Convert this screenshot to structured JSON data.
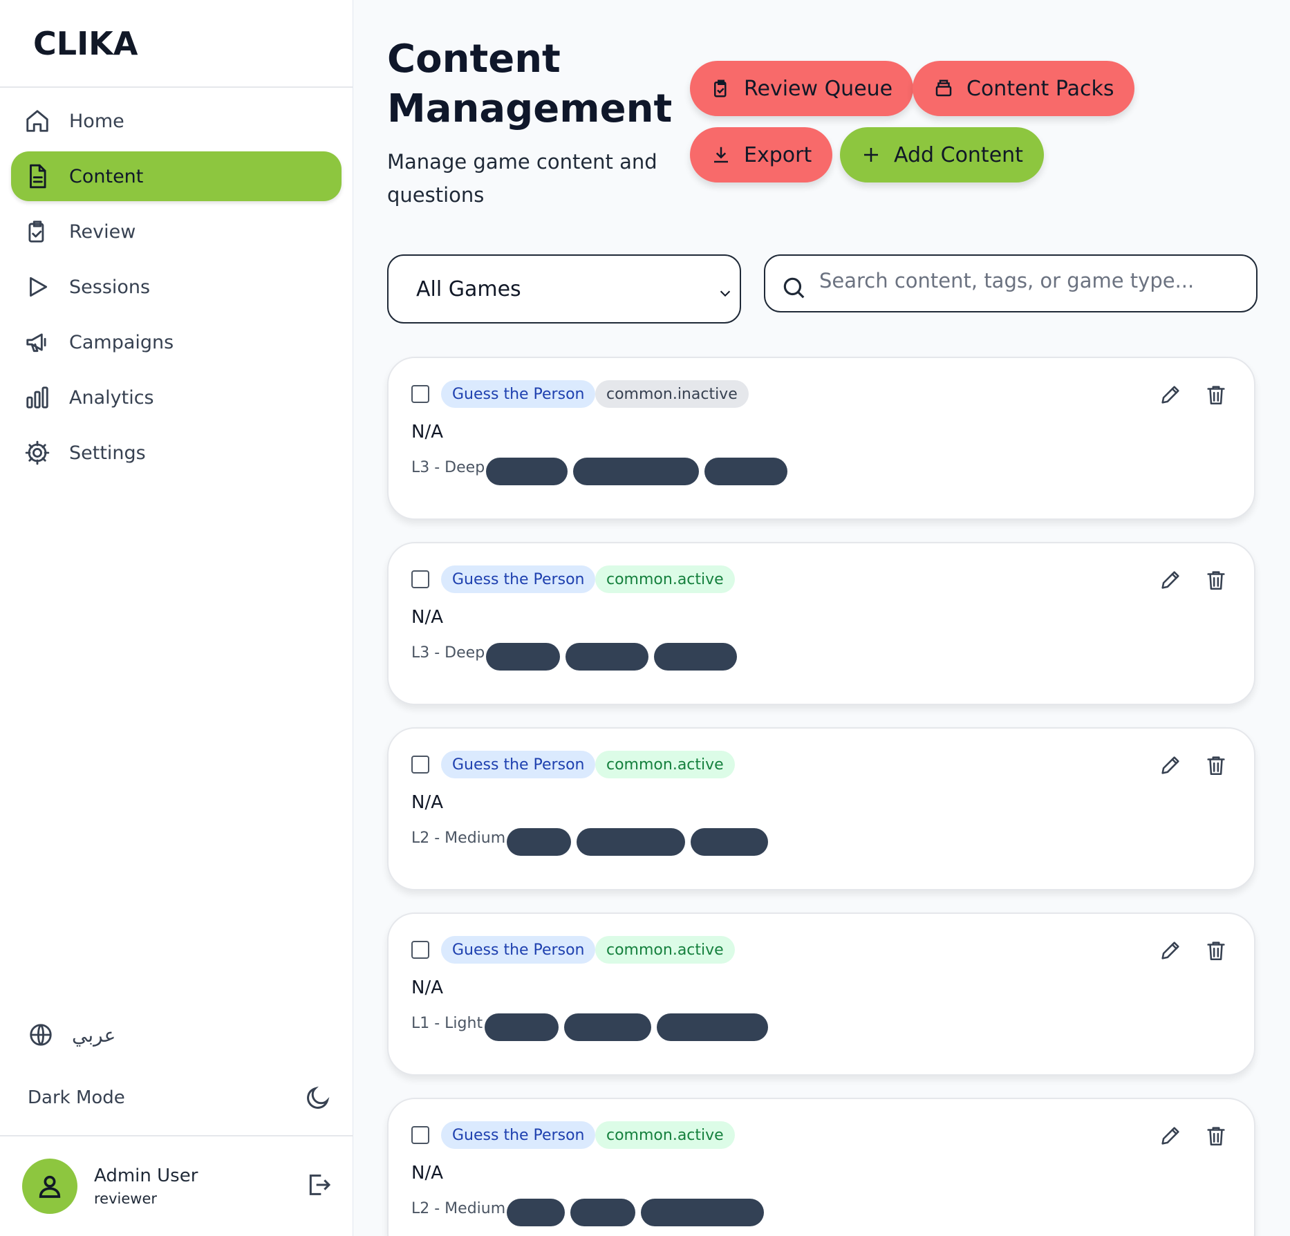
{
  "app": {
    "brand": "CLIKA"
  },
  "sidebar": {
    "items": [
      {
        "label": "Home",
        "icon": "home-icon",
        "active": false
      },
      {
        "label": "Content",
        "icon": "document-icon",
        "active": true
      },
      {
        "label": "Review",
        "icon": "clipboard-check-icon",
        "active": false
      },
      {
        "label": "Sessions",
        "icon": "play-icon",
        "active": false
      },
      {
        "label": "Campaigns",
        "icon": "megaphone-icon",
        "active": false
      },
      {
        "label": "Analytics",
        "icon": "bar-chart-icon",
        "active": false
      },
      {
        "label": "Settings",
        "icon": "gear-icon",
        "active": false
      }
    ],
    "language_label": "عربي",
    "dark_mode_label": "Dark Mode",
    "user": {
      "name": "Admin User",
      "role": "reviewer"
    }
  },
  "header": {
    "title": "Content Management",
    "subtitle": "Manage game content and questions",
    "buttons": {
      "review_queue": "Review Queue",
      "content_packs": "Content Packs",
      "export": "Export",
      "add_content": "Add Content"
    }
  },
  "filters": {
    "game_select_value": "All Games",
    "search_placeholder": "Search content, tags, or game type..."
  },
  "colors": {
    "accent_green": "#8dc63f",
    "accent_red": "#f86a6a",
    "tag_blue_bg": "#dbeafe",
    "tag_green_bg": "#dcfce7",
    "pill_dark": "#334155"
  },
  "content_items": [
    {
      "game": "Guess the Person",
      "status": "common.inactive",
      "status_kind": "inactive",
      "title": "N/A",
      "level": "L3 - Deep"
    },
    {
      "game": "Guess the Person",
      "status": "common.active",
      "status_kind": "active",
      "title": "N/A",
      "level": "L3 - Deep"
    },
    {
      "game": "Guess the Person",
      "status": "common.active",
      "status_kind": "active",
      "title": "N/A",
      "level": "L2 - Medium"
    },
    {
      "game": "Guess the Person",
      "status": "common.active",
      "status_kind": "active",
      "title": "N/A",
      "level": "L1 - Light"
    },
    {
      "game": "Guess the Person",
      "status": "common.active",
      "status_kind": "active",
      "title": "N/A",
      "level": "L2 - Medium"
    }
  ]
}
